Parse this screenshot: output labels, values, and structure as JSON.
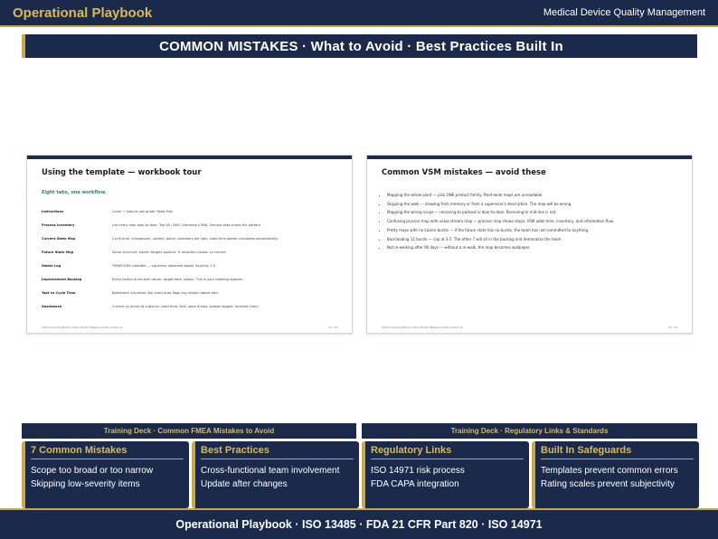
{
  "header": {
    "brand": "Operational Playbook",
    "subtitle": "Medical Device Quality Management"
  },
  "banner": {
    "title": "COMMON MISTAKES  ·  What to Avoid  ·  Best Practices Built In"
  },
  "slides": {
    "left": {
      "title": "Using the template — workbook tour",
      "subheading": "Eight tabs, one workflow.",
      "rows": [
        {
          "name": "Instructions",
          "desc": "Cover + how-to-use guide. Read first."
        },
        {
          "name": "Process Inventory",
          "desc": "List every step door-to-door. Tag VA / NVA / Necessary NVA. Sample data shows the pattern."
        },
        {
          "name": "Current State Map",
          "desc": "Cycle time, changeover, uptime, batch, operators per step. Lead time ladder calculates automatically."
        },
        {
          "name": "Future State Map",
          "desc": "Same structure, kaizen targets applied. % reduction shown vs current."
        },
        {
          "name": "Waste Log",
          "desc": "TIMWOODS classifier — log every observed waste. Severity 1-5."
        },
        {
          "name": "Improvement Backlog",
          "desc": "Every kaizen burst with owner, target date, status. This is your meeting agenda."
        },
        {
          "name": "Takt vs Cycle Time",
          "desc": "Bottleneck visualizer. Bar chart auto-flags any station above takt."
        },
        {
          "name": "Dashboard",
          "desc": "Current vs future at a glance. Lead time, NVA, open bursts, wastes logged. Includes chart."
        }
      ],
      "footer_left": "Client Company Name  |  Value Stream Mapping Training Deck v1",
      "footer_right": "10 / 24"
    },
    "right": {
      "title": "Common VSM mistakes — avoid these",
      "items": [
        "Mapping the whole plant — pick ONE product family. Plant-wide maps are unreadable.",
        "Skipping the walk — drawing from memory or from a supervisor's description. The map will be wrong.",
        "Mapping the wrong scope — receiving to packout is door-to-door. Receiving to mid-line is not.",
        "Confusing process map with value stream map — process map shows steps; VSM adds time, inventory, and information flow.",
        "Pretty maps with no kaizen bursts — if the future state has no bursts, the team has not committed to anything.",
        "Backloading 12 bursts — cap at 3-5. The other 7 will sit in the backlog and demoralize the team.",
        "Not re-walking after 90 days — without a re-walk, the map becomes wallpaper."
      ],
      "footer_left": "Client Company Name  |  Value Stream Mapping Training Deck v1",
      "footer_right": "22 / 24"
    }
  },
  "sections": {
    "left": "Training Deck · Common FMEA Mistakes to Avoid",
    "right": "Training Deck · Regulatory Links & Standards"
  },
  "cards": [
    {
      "title": "7 Common Mistakes",
      "items": [
        "Scope too broad or too narrow",
        "Skipping low-severity items"
      ]
    },
    {
      "title": "Best Practices",
      "items": [
        "Cross-functional team involvement",
        "Update after changes"
      ]
    },
    {
      "title": "Regulatory Links",
      "items": [
        "ISO 14971 risk process",
        "FDA CAPA integration"
      ]
    },
    {
      "title": "Built In Safeguards",
      "items": [
        "Templates prevent common errors",
        "Rating scales prevent subjectivity"
      ]
    }
  ],
  "footer": {
    "text": "Operational Playbook  ·  ISO 13485  ·  FDA 21 CFR Part 820  ·  ISO 14971"
  },
  "colors": {
    "navy": "#1b2a4a",
    "gold": "#c9a84c",
    "teal": "#178a8a"
  }
}
